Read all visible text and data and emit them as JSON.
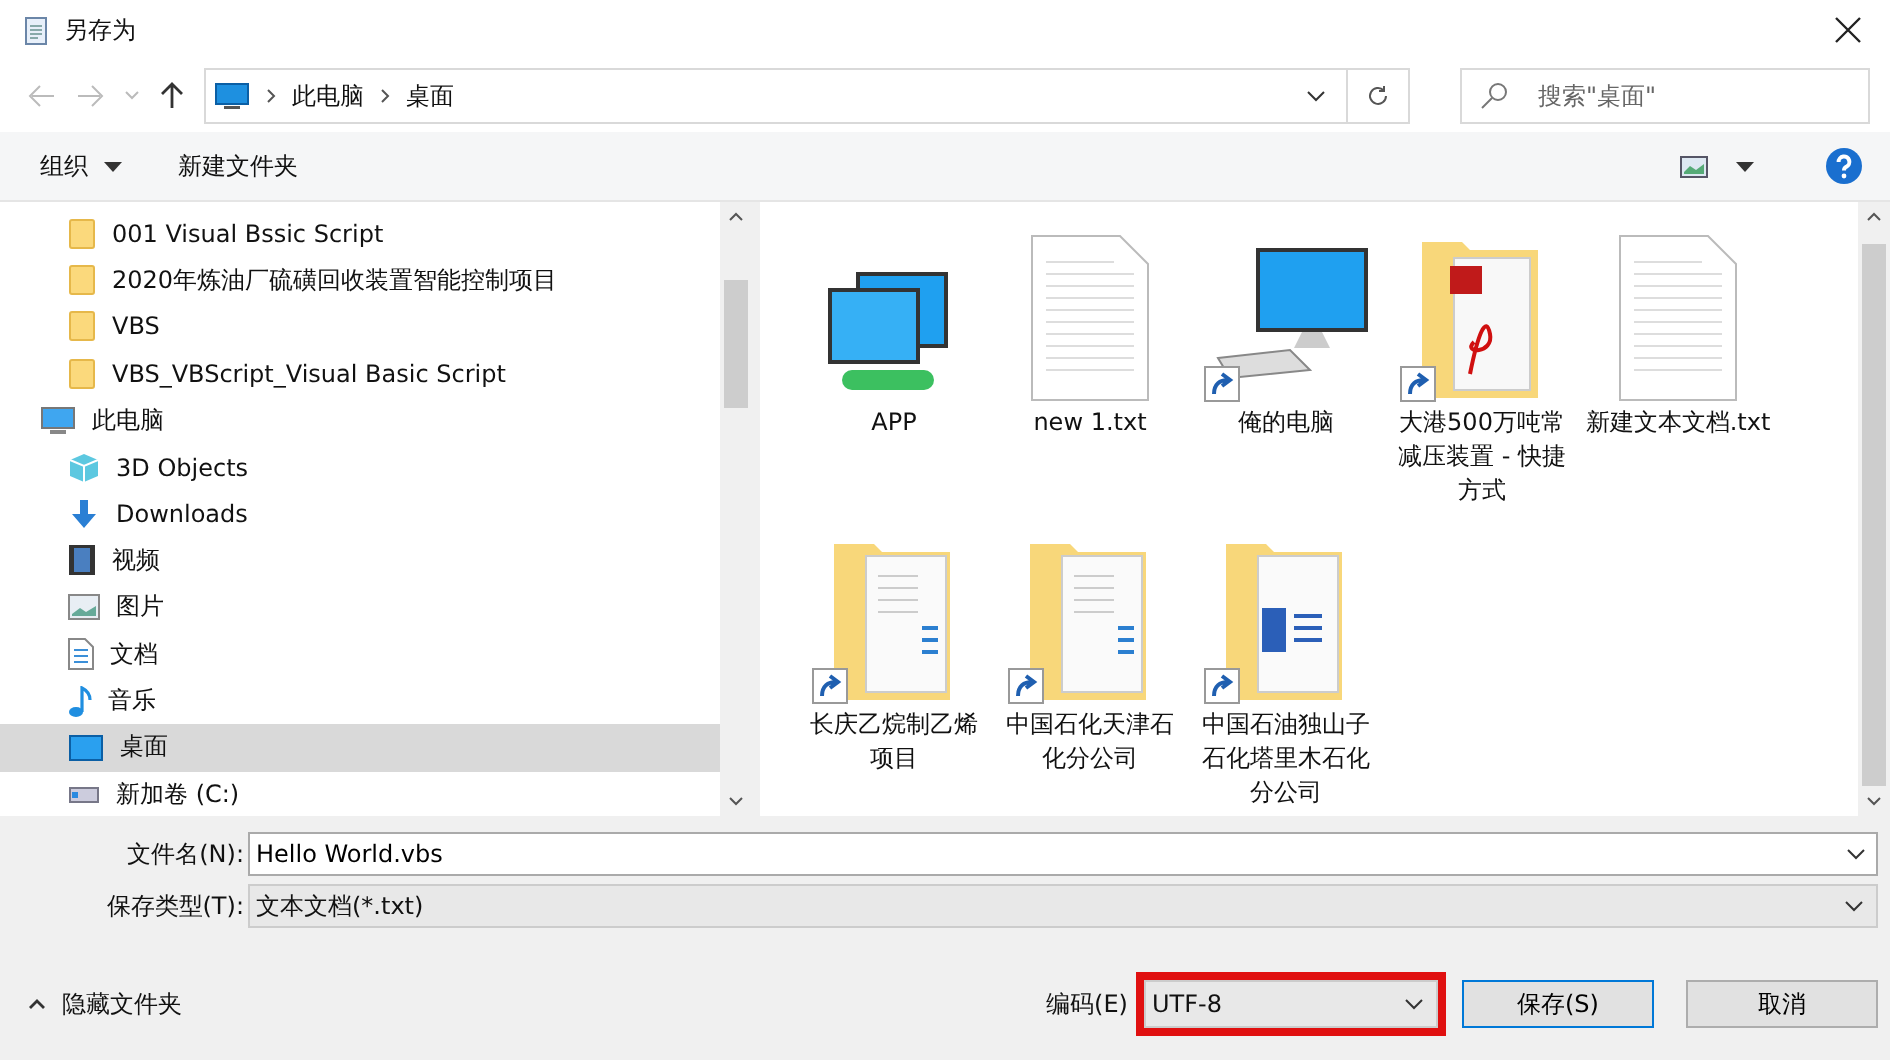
{
  "window": {
    "title": "另存为"
  },
  "address": {
    "path": [
      "此电脑",
      "桌面"
    ]
  },
  "search": {
    "placeholder": "搜索\"桌面\""
  },
  "toolbar": {
    "organize": "组织",
    "new_folder": "新建文件夹"
  },
  "sidebar": {
    "items": [
      {
        "label": "001 Visual Bssic Script",
        "kind": "folder",
        "selected": false
      },
      {
        "label": "2020年炼油厂硫磺回收装置智能控制项目",
        "kind": "folder",
        "selected": false
      },
      {
        "label": "VBS",
        "kind": "folder",
        "selected": false
      },
      {
        "label": "VBS_VBScript_Visual Basic Script",
        "kind": "folder",
        "selected": false
      },
      {
        "label": "此电脑",
        "kind": "pc",
        "selected": false
      },
      {
        "label": "3D Objects",
        "kind": "cube",
        "selected": false
      },
      {
        "label": "Downloads",
        "kind": "download",
        "selected": false
      },
      {
        "label": "视频",
        "kind": "video",
        "selected": false
      },
      {
        "label": "图片",
        "kind": "picture",
        "selected": false
      },
      {
        "label": "文档",
        "kind": "document",
        "selected": false
      },
      {
        "label": "音乐",
        "kind": "music",
        "selected": false
      },
      {
        "label": "桌面",
        "kind": "desktop",
        "selected": true
      },
      {
        "label": "新加卷 (C:)",
        "kind": "drive",
        "selected": false
      }
    ]
  },
  "files": [
    {
      "name": "APP",
      "kind": "network",
      "shortcut": false
    },
    {
      "name": "new 1.txt",
      "kind": "text",
      "shortcut": false
    },
    {
      "name": "俺的电脑",
      "kind": "computer",
      "shortcut": true
    },
    {
      "name": "大港500万吨常减压装置 - 快捷方式",
      "kind": "pdf-folder",
      "shortcut": true
    },
    {
      "name": "新建文本文档.txt",
      "kind": "text",
      "shortcut": false
    },
    {
      "name": "长庆乙烷制乙烯项目",
      "kind": "folder",
      "shortcut": true
    },
    {
      "name": "中国石化天津石化分公司",
      "kind": "folder",
      "shortcut": true
    },
    {
      "name": "中国石油独山子石化塔里木石化分公司",
      "kind": "word-folder",
      "shortcut": true
    }
  ],
  "form": {
    "filename_label": "文件名(N):",
    "filename": "Hello World.vbs",
    "type_label": "保存类型(T):",
    "type": "文本文档(*.txt)"
  },
  "footer": {
    "hide_folders": "隐藏文件夹",
    "encoding_label": "编码(E)",
    "encoding": "UTF-8",
    "encoding_highlighted": true,
    "save": "保存(S)",
    "cancel": "取消"
  }
}
